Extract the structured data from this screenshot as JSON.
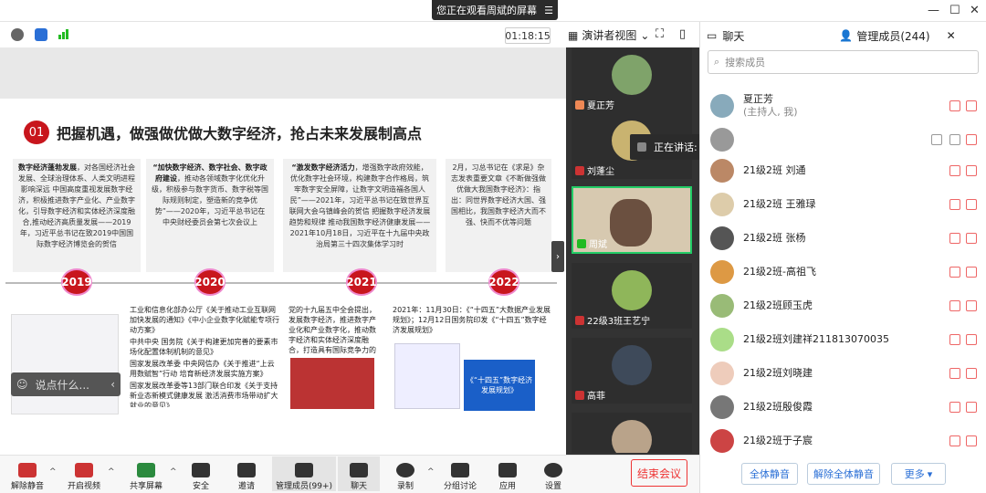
{
  "topbar": {
    "share_banner": "您正在观看周斌的屏幕",
    "menu_icon": "menu-icon",
    "window_controls": [
      "minimize-icon",
      "restore-icon",
      "close-icon"
    ]
  },
  "toolbar": {
    "timer": "01:18:15",
    "view_label": "演讲者视图"
  },
  "slide": {
    "number": "01",
    "heading": "把握机遇，做强做优做大数字经济，抢占未来发展制高点",
    "cards": [
      {
        "bold": "数字经济蓬勃发展",
        "text": "，对各国经济社会发展、全球治理体系、人类文明进程影响深远 中国高度重视发展数字经济，积极推进数字产业化、产业数字化，引导数字经济和实体经济深度融合,推动经济高质量发展——2019年，习近平总书记在致2019中国国际数字经济博览会的贺信"
      },
      {
        "bold": "“加快数字经济、数字社会、数字政府建设",
        "text": "，推动各领域数字化优化升级，积极参与数字货币、数字税等国际规则制定，塑造新的竞争优势”——2020年，习近平总书记在中央财经委员会第七次会议上"
      },
      {
        "bold": "“激发数字经济活力",
        "text": "，增强数字政府效能，优化数字社会环境，构建数字合作格局，筑牢数字安全屏障，让数字文明造福各国人民”——2021年，习近平总书记在致世界互联网大会乌镇峰会的贺信 把握数字经济发展趋势和规律 推动我国数字经济健康发展——2021年10月18日，习近平在十九届中央政治局第三十四次集体学习时"
      },
      {
        "bold": "",
        "text": "2月，习总书记在《求是》杂志发表重要文章《不断做强做优做大我国数字经济》：指出：同世界数字经济大国、强国相比，我国数字经济大而不强、快而不优等问题"
      }
    ],
    "years": [
      "2019",
      "2020",
      "2021",
      "2022"
    ],
    "col2020": [
      "工业和信息化部办公厅《关于推动工业互联网加快发展的通知》《中小企业数字化赋能专项行动方案》",
      "中共中央 国务院《关于构建更加完善的要素市场化配置体制机制的意见》",
      "国家发展改革委 中央网信办《关于推进“上云用数赋智”行动 培育新经济发展实施方案》",
      "国家发展改革委等13部门联合印发《关于支持新业态新模式健康发展 激活消费市场带动扩大就业的意见》"
    ],
    "col2021": "党的十九届五中全会提出，发展数字经济，推进数字产业化和产业数字化，推动数字经济和实体经济深度融合，打造具有国际竞争力的数字产业集群。",
    "col2022": "2021年：11月30日：《“十四五”大数据产业发展规划》；12月12日国务院印发《“十四五”数字经济发展规划》",
    "thumb2022": "《“十四五”数字经济发展规划》",
    "say_placeholder": "说点什么...",
    "collapse_icon": "chevron-right-icon"
  },
  "video": {
    "tiles": [
      {
        "name": "夏正芳",
        "color": "#7fa36a"
      },
      {
        "name": "刘蓬尘",
        "color": "#c9b370"
      },
      {
        "name": "周斌",
        "color": "#d7c9b0"
      },
      {
        "name": "22级3班王艺宁",
        "color": "#8fb65a"
      },
      {
        "name": "高菲",
        "color": "#3e4a5a"
      },
      {
        "name": "",
        "color": "#b9a38a"
      }
    ],
    "speaking": "正在讲话: 周斌;"
  },
  "bottombar": {
    "buttons": [
      "解除静音",
      "开启视频",
      "共享屏幕",
      "安全",
      "邀请",
      "管理成员(99+)",
      "聊天",
      "录制",
      "分组讨论",
      "应用",
      "设置"
    ],
    "end_meeting": "结束会议"
  },
  "panel": {
    "tab_chat": "聊天",
    "tab_members": "管理成员(244)",
    "search_placeholder": "搜索成员",
    "members": [
      {
        "name": "夏正芳",
        "sub": "(主持人, 我)",
        "color": "#8ab"
      },
      {
        "name": "",
        "sub": "",
        "color": "#999"
      },
      {
        "name": "21级2班 刘通",
        "sub": "",
        "color": "#b86"
      },
      {
        "name": "21级2班 王雅琭",
        "sub": "",
        "color": "#dca"
      },
      {
        "name": "21级2班 张杨",
        "sub": "",
        "color": "#555"
      },
      {
        "name": "21级2班-高祖飞",
        "sub": "",
        "color": "#d94"
      },
      {
        "name": "21级2班顾玉虎",
        "sub": "",
        "color": "#9b7"
      },
      {
        "name": "21级2班刘建祥211813070035",
        "sub": "",
        "color": "#ad8"
      },
      {
        "name": "21级2班刘晓建",
        "sub": "",
        "color": "#ecb"
      },
      {
        "name": "21级2班殷俊霞",
        "sub": "",
        "color": "#777"
      },
      {
        "name": "21级2班于子宸",
        "sub": "",
        "color": "#c44"
      }
    ],
    "mute_all": "全体静音",
    "unmute_all": "解除全体静音",
    "more": "更多"
  }
}
